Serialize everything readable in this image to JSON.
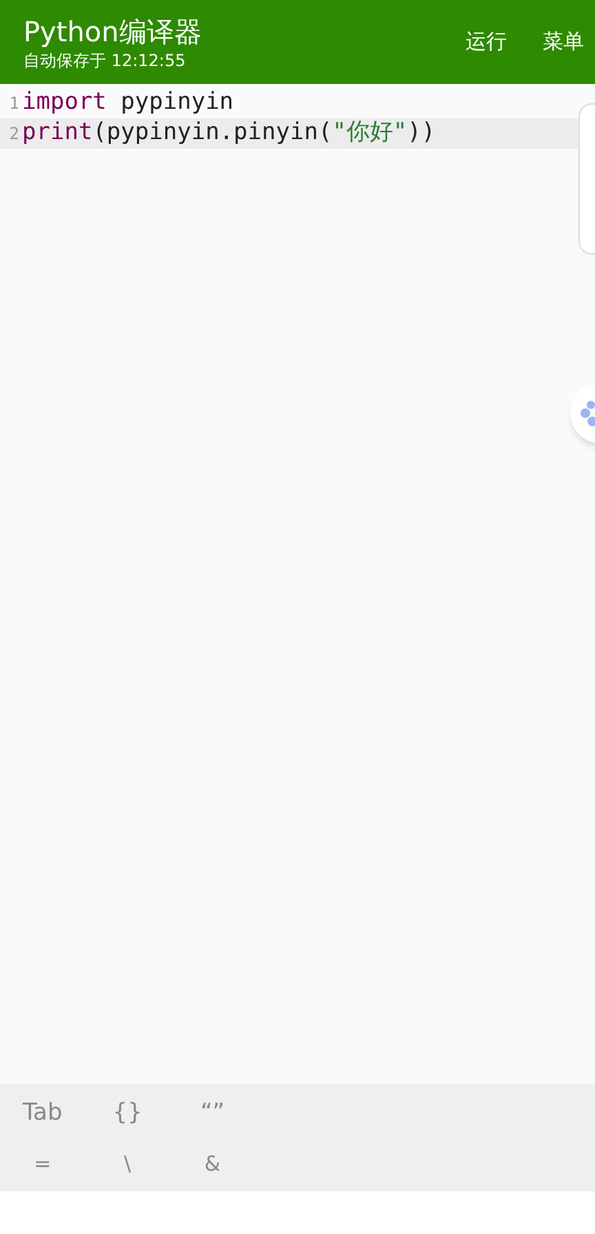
{
  "app_bar": {
    "title": "Python编译器",
    "subtitle": "自动保存于 12:12:55",
    "actions": [
      "运行",
      "菜单"
    ]
  },
  "editor": {
    "lines": [
      {
        "number": "1",
        "current": false,
        "tokens": [
          {
            "kind": "keyword",
            "text": "import"
          },
          {
            "kind": "plain",
            "text": " pypinyin"
          }
        ]
      },
      {
        "number": "2",
        "current": true,
        "tokens": [
          {
            "kind": "keyword",
            "text": "print"
          },
          {
            "kind": "plain",
            "text": "(pypinyin.pinyin("
          },
          {
            "kind": "string",
            "text": "\"你好\""
          },
          {
            "kind": "plain",
            "text": "))"
          }
        ]
      }
    ]
  },
  "symbol_bar": {
    "rows": [
      [
        "Tab",
        "{}",
        "“”"
      ],
      [
        "=",
        "\\",
        "&"
      ]
    ]
  }
}
